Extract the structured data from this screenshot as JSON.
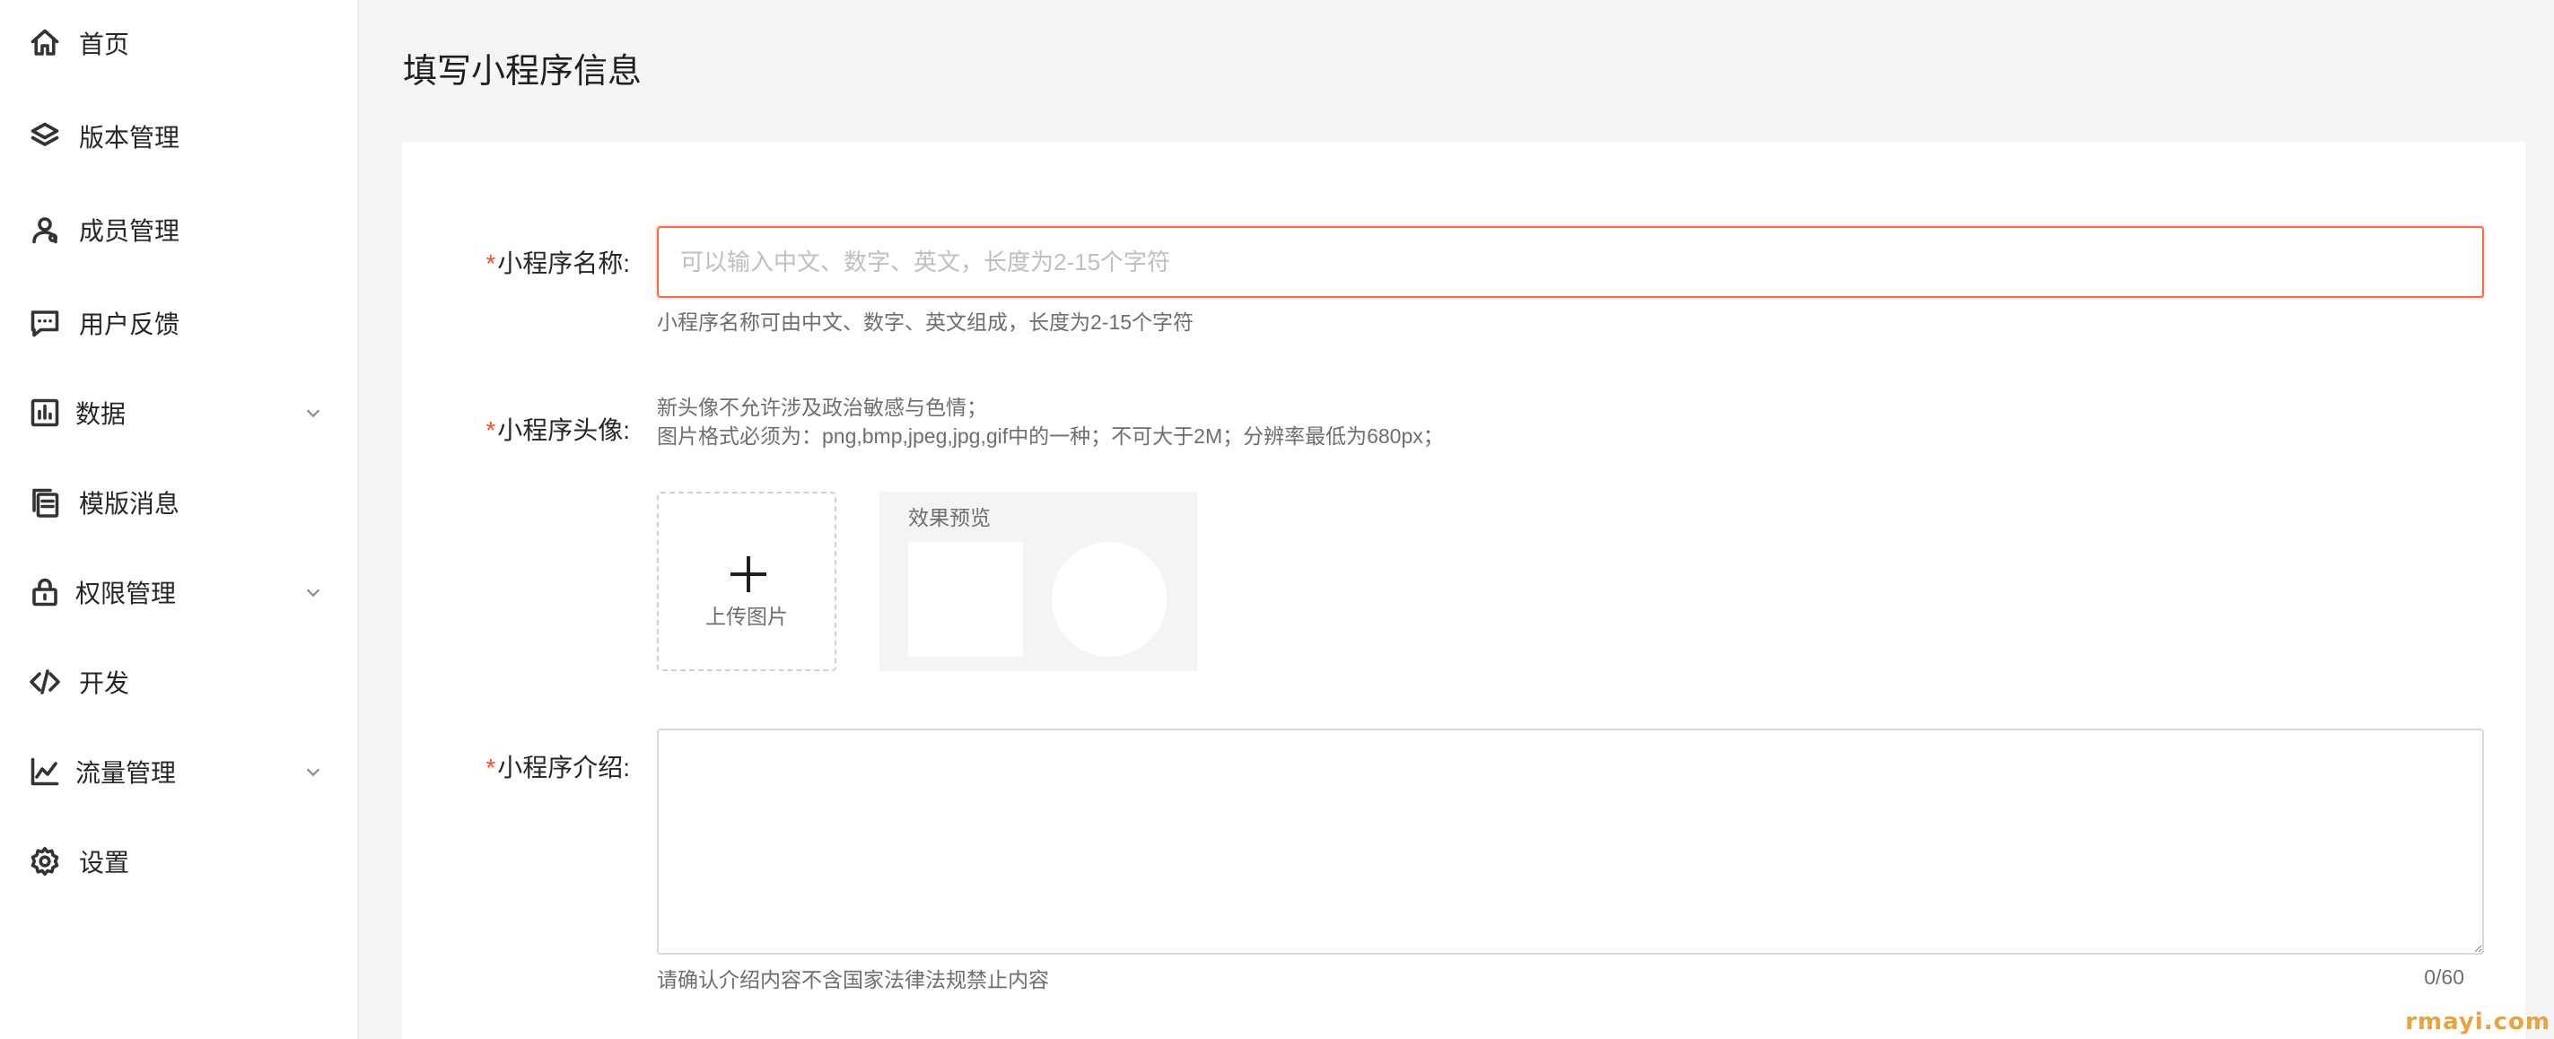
{
  "sidebar": {
    "items": [
      {
        "label": "首页",
        "icon": "home-icon",
        "has_submenu": false
      },
      {
        "label": "版本管理",
        "icon": "layers-icon",
        "has_submenu": false
      },
      {
        "label": "成员管理",
        "icon": "user-icon",
        "has_submenu": false
      },
      {
        "label": "用户反馈",
        "icon": "message-icon",
        "has_submenu": false
      },
      {
        "label": "数据",
        "icon": "bar-chart-icon",
        "has_submenu": true
      },
      {
        "label": "模版消息",
        "icon": "copy-icon",
        "has_submenu": false
      },
      {
        "label": "权限管理",
        "icon": "lock-icon",
        "has_submenu": true
      },
      {
        "label": "开发",
        "icon": "code-icon",
        "has_submenu": false
      },
      {
        "label": "流量管理",
        "icon": "line-chart-icon",
        "has_submenu": true
      },
      {
        "label": "设置",
        "icon": "gear-icon",
        "has_submenu": false
      }
    ]
  },
  "page": {
    "title": "填写小程序信息"
  },
  "form": {
    "required_mark": "*",
    "name": {
      "label": "小程序名称:",
      "value": "",
      "placeholder": "可以输入中文、数字、英文，长度为2-15个字符",
      "hint": "小程序名称可由中文、数字、英文组成，长度为2-15个字符"
    },
    "avatar": {
      "label": "小程序头像:",
      "hint_line1": "新头像不允许涉及政治敏感与色情；",
      "hint_line2": "图片格式必须为：png,bmp,jpeg,jpg,gif中的一种；不可大于2M；分辨率最低为680px；",
      "upload_label": "上传图片",
      "preview_title": "效果预览"
    },
    "intro": {
      "label": "小程序介绍:",
      "value": "",
      "hint": "请确认介绍内容不含国家法律法规禁止内容",
      "counter": "0/60"
    }
  },
  "watermark": "rmayi.com",
  "colors": {
    "accent": "#ff6a3d",
    "required": "#ff4d1a",
    "background": "#f5f5f7"
  }
}
